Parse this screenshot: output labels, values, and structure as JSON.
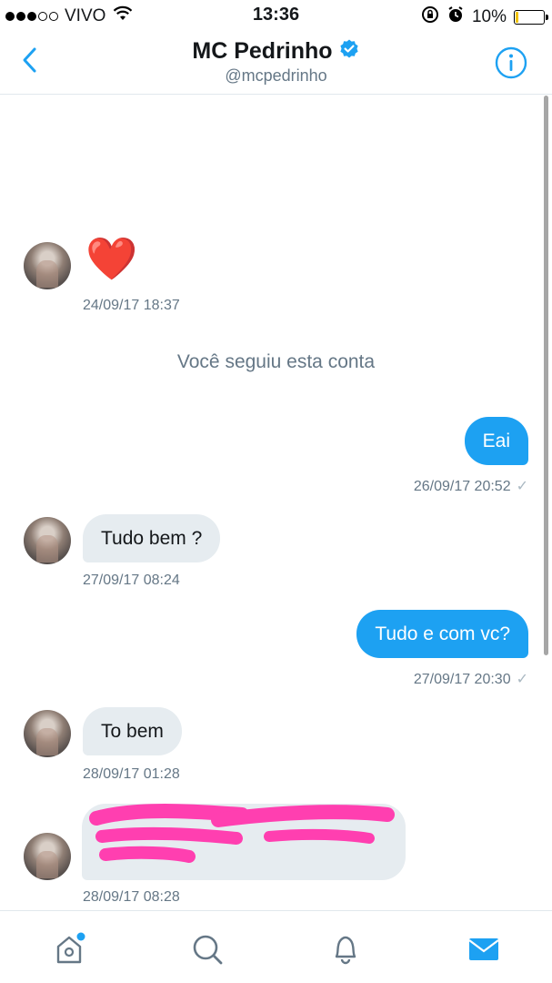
{
  "status_bar": {
    "carrier": "VIVO",
    "time": "13:36",
    "battery_percent": "10%",
    "battery_level": 0.1,
    "colors": {
      "battery": "#f3c300"
    }
  },
  "header": {
    "title": "MC Pedrinho",
    "handle": "@mcpedrinho",
    "verified": true,
    "icons": {
      "back": "chevron-left-icon",
      "info": "info-icon",
      "verified": "verified-badge-icon"
    }
  },
  "conversation": {
    "messages": [
      {
        "direction": "in",
        "text": "❤️",
        "timestamp": "24/09/17 18:37"
      },
      {
        "direction": "notice",
        "text": "Você seguiu esta conta"
      },
      {
        "direction": "out",
        "text": "Eai",
        "timestamp": "26/09/17 20:52",
        "read_mark": "✓"
      },
      {
        "direction": "in",
        "text": "Tudo bem ?",
        "timestamp": "27/09/17 08:24"
      },
      {
        "direction": "out",
        "text": "Tudo e com vc?",
        "timestamp": "27/09/17 20:30",
        "read_mark": "✓"
      },
      {
        "direction": "in",
        "text": "To bem",
        "timestamp": "28/09/17 01:28"
      },
      {
        "direction": "in",
        "text": "",
        "redacted": true,
        "timestamp": "28/09/17 08:28"
      }
    ]
  },
  "tab_bar": {
    "tabs": [
      {
        "name": "home",
        "icon": "home-icon",
        "has_notification_dot": true
      },
      {
        "name": "search",
        "icon": "search-icon"
      },
      {
        "name": "notifications",
        "icon": "bell-icon"
      },
      {
        "name": "messages",
        "icon": "envelope-icon",
        "active": true
      }
    ]
  },
  "colors": {
    "accent": "#1da1f2",
    "incoming_bubble": "#e6ecf0",
    "secondary_text": "#657786",
    "redaction": "#ff3fb0"
  }
}
